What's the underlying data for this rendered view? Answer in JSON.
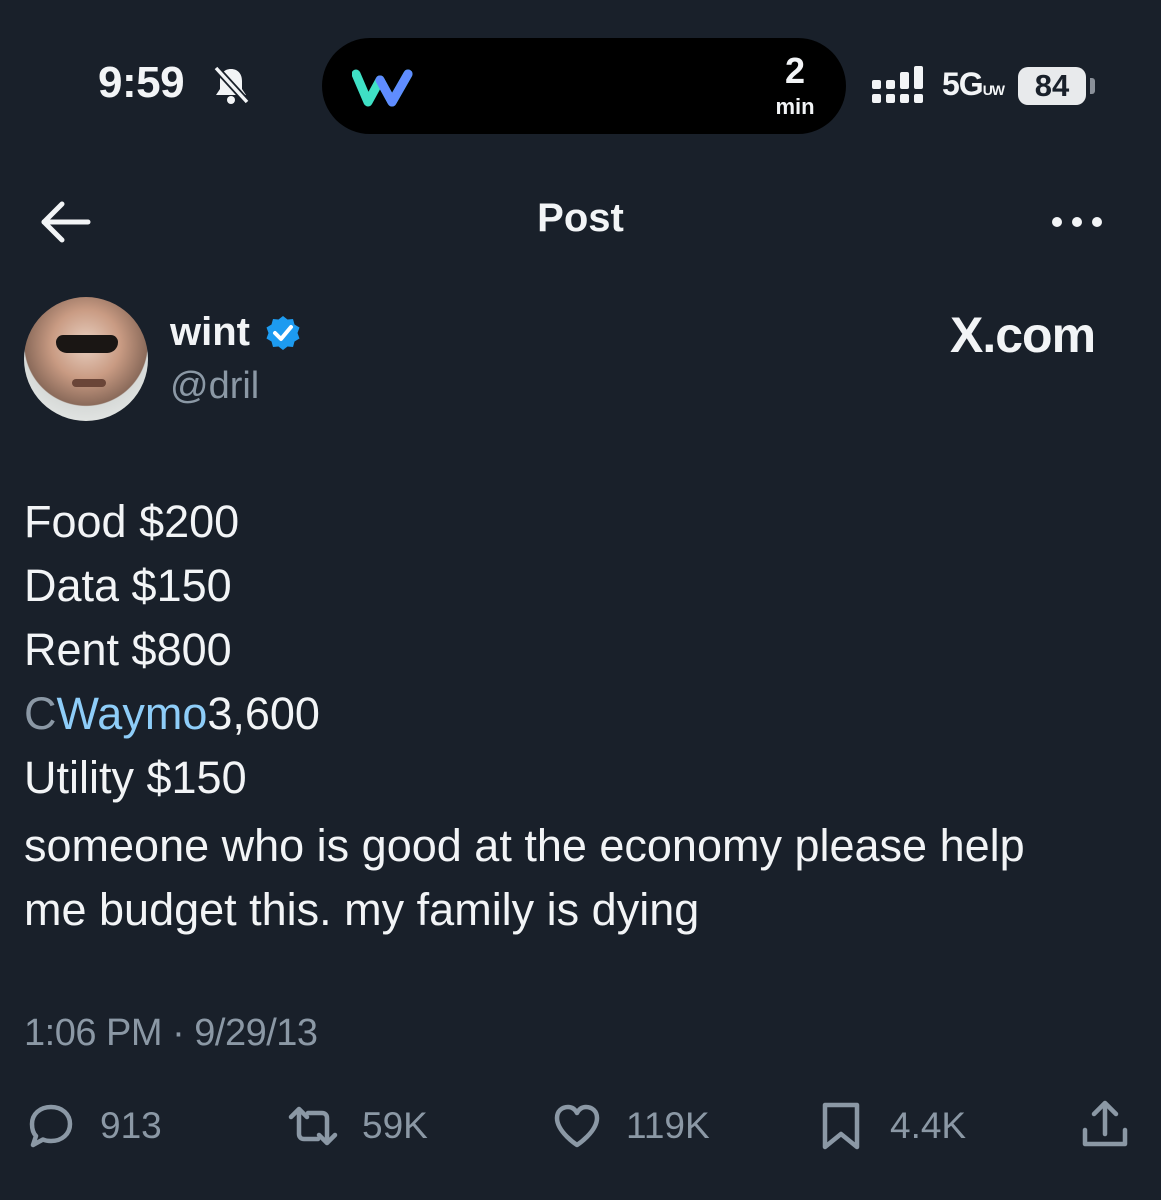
{
  "status_bar": {
    "time": "9:59",
    "live_activity": {
      "eta_value": "2",
      "eta_unit": "min"
    },
    "network": "5G",
    "network_badge": "UW",
    "battery": "84"
  },
  "header": {
    "title": "Post"
  },
  "author": {
    "name": "wint",
    "handle": "@dril",
    "source": "X.com"
  },
  "post": {
    "lines": [
      "Food $200",
      "Data $150",
      "Rent $800",
      "Utility $150",
      "someone who is good at the economy please help",
      "me budget this. my family is dying"
    ],
    "edited_line": {
      "prefix": "C",
      "overlay": "Waymo",
      "suffix": "3,600"
    },
    "timestamp": "1:06 PM · 9/29/13"
  },
  "actions": {
    "replies": "913",
    "reposts": "59K",
    "likes": "119K",
    "bookmarks": "4.4K"
  },
  "colors": {
    "background": "#19202a",
    "text": "#f2f4f6",
    "muted": "#8b98a5",
    "verified": "#1d9bf0",
    "waymo_text": "#8ecdf8"
  }
}
